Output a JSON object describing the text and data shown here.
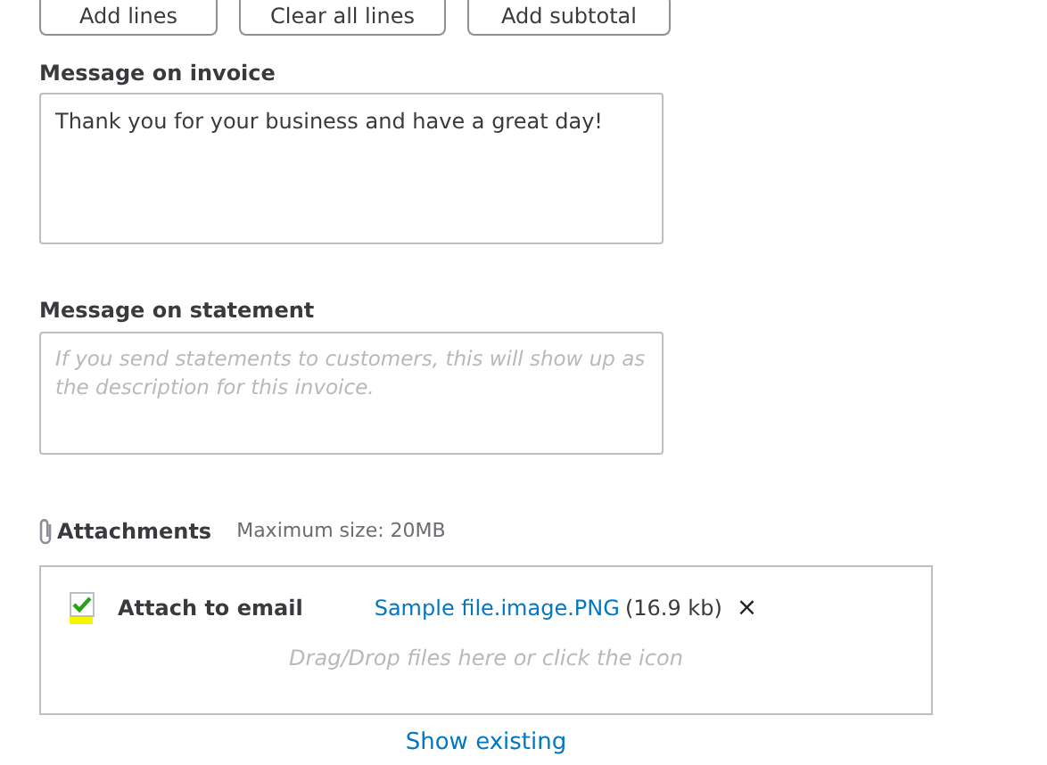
{
  "buttons": [
    "Add lines",
    "Clear all lines",
    "Add subtotal"
  ],
  "invoice_message": {
    "label": "Message on invoice",
    "value": "Thank you for your business and have a great day!"
  },
  "statement_message": {
    "label": "Message on statement",
    "placeholder": "If you send statements to customers, this will show up as the description for this invoice."
  },
  "attachments": {
    "label": "Attachments",
    "max_size": "Maximum size: 20MB",
    "attach_to_email": {
      "label": "Attach to email",
      "checked": true
    },
    "file": {
      "name": "Sample file.image.PNG",
      "size": "(16.9 kb)",
      "remove": "×"
    },
    "drop_hint": "Drag/Drop files here or click the icon",
    "show_existing": "Show existing"
  }
}
